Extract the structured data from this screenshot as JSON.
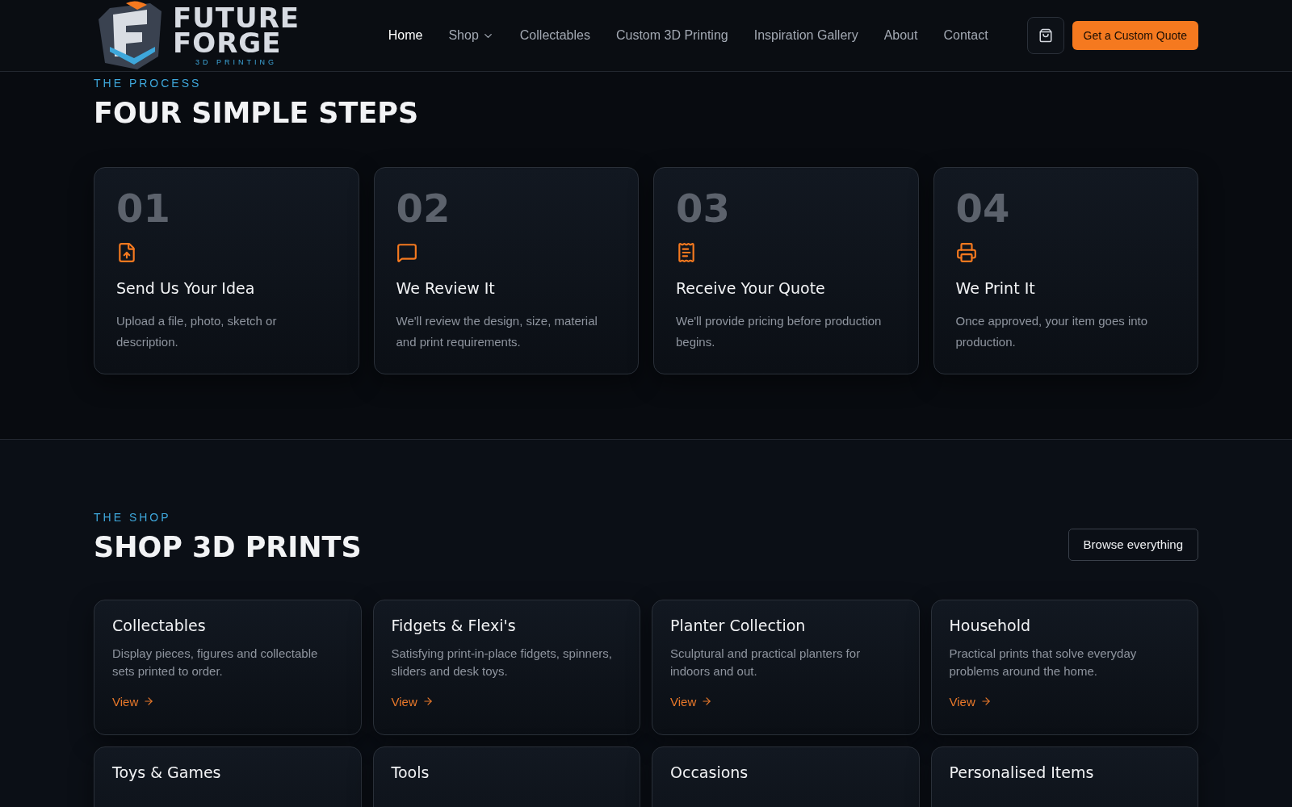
{
  "logo": {
    "name_line_1": "FUTURE",
    "name_line_2": "FORGE",
    "tagline": "3D PRINTING"
  },
  "nav": [
    {
      "label": "Home",
      "selected": true,
      "kind": "link"
    },
    {
      "label": "Shop",
      "selected": false,
      "kind": "dropdown"
    },
    {
      "label": "Collectables",
      "selected": false,
      "kind": "link"
    },
    {
      "label": "Custom 3D Printing",
      "selected": false,
      "kind": "link"
    },
    {
      "label": "Inspiration Gallery",
      "selected": false,
      "kind": "link"
    },
    {
      "label": "About",
      "selected": false,
      "kind": "link"
    },
    {
      "label": "Contact",
      "selected": false,
      "kind": "link"
    }
  ],
  "cta": "Get a Custom Quote",
  "process": {
    "eyebrow": "THE PROCESS",
    "heading": "FOUR SIMPLE STEPS",
    "steps": [
      {
        "number": "01",
        "title": "Send Us Your Idea",
        "text": "Upload a file, photo, sketch or description."
      },
      {
        "number": "02",
        "title": "We Review It",
        "text": "We'll review the design, size, material and print requirements."
      },
      {
        "number": "03",
        "title": "Receive Your Quote",
        "text": "We'll provide pricing before production begins."
      },
      {
        "number": "04",
        "title": "We Print It",
        "text": "Once approved, your item goes into production."
      }
    ]
  },
  "shop": {
    "eyebrow": "THE SHOP",
    "heading": "SHOP 3D PRINTS",
    "browse": "Browse everything",
    "categories": [
      {
        "title": "Collectables",
        "text": "Display pieces, figures and collectable sets printed to order.",
        "link": "View"
      },
      {
        "title": "Fidgets & Flexi's",
        "text": "Satisfying print-in-place fidgets, spinners, sliders and desk toys.",
        "link": "View"
      },
      {
        "title": "Planter Collection",
        "text": "Sculptural and practical planters for indoors and out.",
        "link": "View"
      },
      {
        "title": "Household",
        "text": "Practical prints that solve everyday problems around the home.",
        "link": "View"
      },
      {
        "title": "Toys & Games"
      },
      {
        "title": "Tools"
      },
      {
        "title": "Occasions"
      },
      {
        "title": "Personalised Items"
      }
    ]
  }
}
